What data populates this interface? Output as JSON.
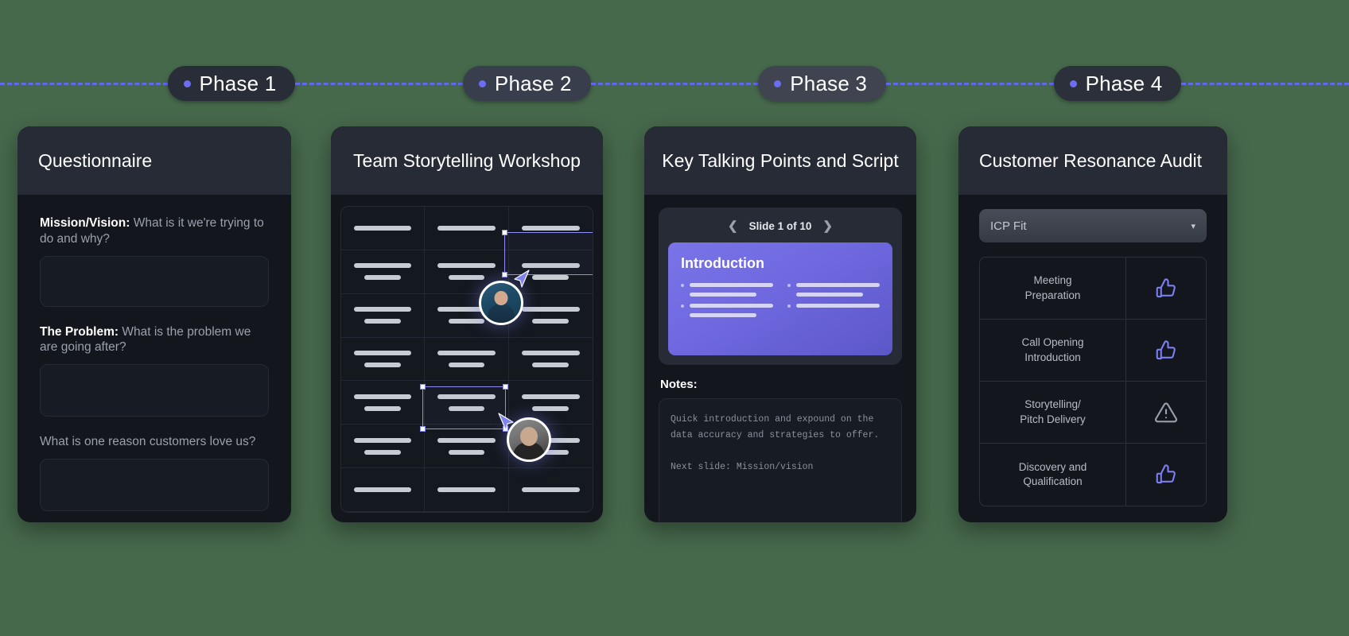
{
  "phases": [
    {
      "label": "Phase 1"
    },
    {
      "label": "Phase 2"
    },
    {
      "label": "Phase 3"
    },
    {
      "label": "Phase 4"
    }
  ],
  "colors": {
    "background": "#46694c",
    "accent": "#6366f1",
    "card_bg": "#13161d",
    "card_header": "#262b36",
    "slide_purple": "#6f68df"
  },
  "cards": [
    {
      "title": "Questionnaire",
      "questions": [
        {
          "bold": "Mission/Vision:",
          "rest": " What is it we're trying to do and why?"
        },
        {
          "bold": "The Problem:",
          "rest": " What is the problem we are going after?"
        },
        {
          "bold": "",
          "rest": "What is one reason customers love us?"
        }
      ]
    },
    {
      "title": "Team Storytelling Workshop",
      "collaborators": [
        {
          "name": "collaborator-1"
        },
        {
          "name": "collaborator-2"
        }
      ]
    },
    {
      "title": "Key Talking Points and Script",
      "slide_nav": {
        "prev_icon": "chevron-left-icon",
        "counter": "Slide 1 of 10",
        "next_icon": "chevron-right-icon"
      },
      "slide": {
        "title": "Introduction"
      },
      "notes_label": "Notes:",
      "notes_text": "Quick introduction and expound on the\ndata accuracy and strategies to offer.\n\nNext slide: Mission/vision"
    },
    {
      "title": "Customer Resonance Audit",
      "filter": {
        "value": "ICP Fit",
        "caret_icon": "chevron-down-icon"
      },
      "rows": [
        {
          "label": "Meeting\nPreparation",
          "icon": "thumbs-up-icon"
        },
        {
          "label": "Call Opening\nIntroduction",
          "icon": "thumbs-up-icon"
        },
        {
          "label": "Storytelling/\nPitch Delivery",
          "icon": "warning-icon"
        },
        {
          "label": "Discovery and\nQualification",
          "icon": "thumbs-up-icon"
        }
      ]
    }
  ]
}
